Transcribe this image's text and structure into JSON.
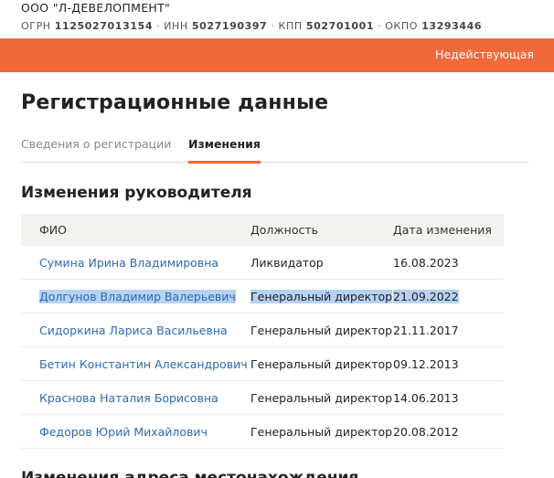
{
  "company": {
    "name": "ООО \"Л-ДЕВЕЛОПМЕНТ\"",
    "ogrn_label": "ОГРН",
    "ogrn": "1125027013154",
    "inn_label": "ИНН",
    "inn": "5027190397",
    "kpp_label": "КПП",
    "kpp": "502701001",
    "okpo_label": "ОКПО",
    "okpo": "13293446"
  },
  "status": {
    "label": "Недействующая"
  },
  "page_title": "Регистрационные данные",
  "tabs": [
    {
      "label": "Сведения о регистрации",
      "active": false
    },
    {
      "label": "Изменения",
      "active": true
    }
  ],
  "directors_section": {
    "title": "Изменения руководителя",
    "columns": [
      "ФИО",
      "Должность",
      "Дата изменения"
    ],
    "rows": [
      {
        "name": "Сумина Ирина Владимировна",
        "position": "Ликвидатор",
        "date": "16.08.2023"
      },
      {
        "name": "Долгунов Владимир Валерьевич",
        "position": "Генеральный директор",
        "date": "21.09.2022"
      },
      {
        "name": "Сидоркина Лариса Васильевна",
        "position": "Генеральный директор",
        "date": "21.11.2017"
      },
      {
        "name": "Бетин Константин Александрович",
        "position": "Генеральный директор",
        "date": "09.12.2013"
      },
      {
        "name": "Краснова Наталия Борисовна",
        "position": "Генеральный директор",
        "date": "14.06.2013"
      },
      {
        "name": "Федоров Юрий Михайлович",
        "position": "Генеральный директор",
        "date": "20.08.2012"
      }
    ]
  },
  "next_section": {
    "title": "Изменения адреса местонахождения"
  },
  "colors": {
    "accent": "#f0693b",
    "link": "#2e6ab1",
    "selection": "#b6d2f2"
  }
}
